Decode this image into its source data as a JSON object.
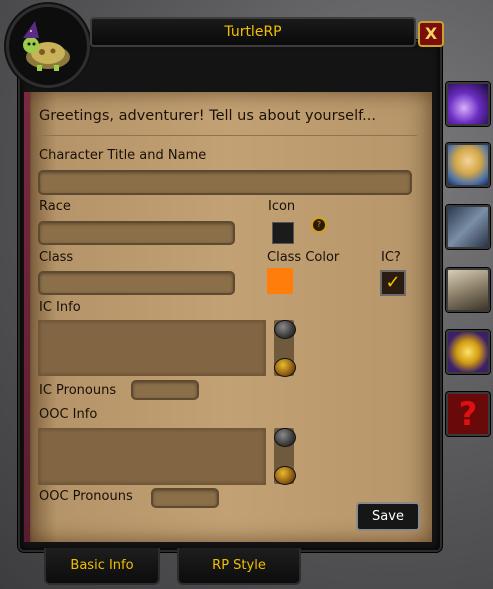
{
  "window": {
    "title": "TurtleRP",
    "close_label": "X",
    "heading": "Greetings, adventurer! Tell us about yourself..."
  },
  "form": {
    "title_name_label": "Character Title and Name",
    "race_label": "Race",
    "icon_label": "Icon",
    "class_label": "Class",
    "class_color_label": "Class Color",
    "class_color_value": "#ff7d0a",
    "ic_label": "IC?",
    "ic_checked": true,
    "ic_info_label": "IC Info",
    "ic_pronouns_label": "IC Pronouns",
    "ooc_info_label": "OOC Info",
    "ooc_pronouns_label": "OOC Pronouns",
    "save_label": "Save"
  },
  "tabs": [
    {
      "label": "Basic Info"
    },
    {
      "label": "RP Style"
    }
  ],
  "side_tabs": [
    {
      "icon": "purple-flame-icon"
    },
    {
      "icon": "character-portrait-icon"
    },
    {
      "icon": "notes-book-icon"
    },
    {
      "icon": "chest-icon"
    },
    {
      "icon": "gold-gear-icon"
    },
    {
      "icon": "question-mark-icon"
    }
  ]
}
